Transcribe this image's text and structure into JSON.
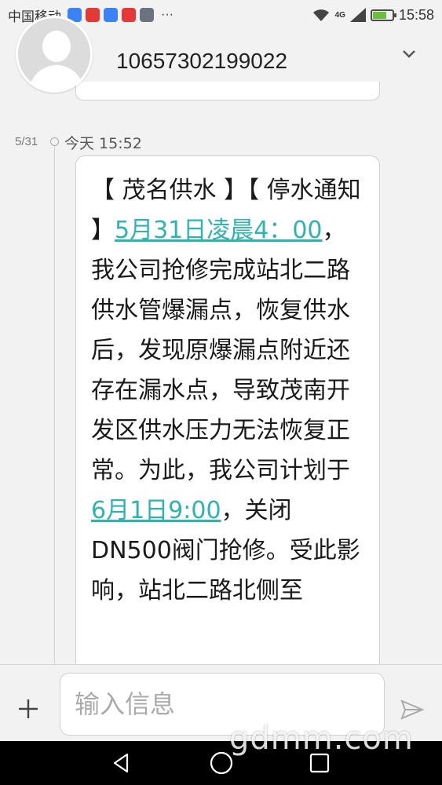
{
  "status_bar": {
    "carrier": "中国移动",
    "dots": "···",
    "network": "4G",
    "time": "15:58",
    "battery_level": 0.7,
    "icons": [
      "shield-app-icon",
      "weibo-app-icon",
      "app-icon",
      "weibo-app-icon",
      "photo-icon"
    ]
  },
  "header": {
    "contact_number": "10657302199022"
  },
  "message": {
    "date": "5/31",
    "time": "今天 15:52",
    "segments": [
      {
        "text": "【 茂名供水 】【 停水通知 】",
        "link": false
      },
      {
        "text": "5月31日凌晨4：00",
        "link": true
      },
      {
        "text": "，我公司抢修完成站北二路供水管爆漏点，恢复供水后，发现原爆漏点附近还存在漏水点，导致茂南开发区供水压力无法恢复正常。为此，我公司计划于",
        "link": false
      },
      {
        "text": "6月1日9:00",
        "link": true
      },
      {
        "text": "，关闭DN500阀门抢修。受此影响，站北二路北侧至",
        "link": false
      }
    ]
  },
  "input": {
    "placeholder": "输入信息"
  },
  "watermark": "gdmm.com",
  "colors": {
    "link": "#2bb5b1",
    "background": "#f2f2f2",
    "bubble": "#ffffff",
    "nav_bar": "#000000"
  }
}
